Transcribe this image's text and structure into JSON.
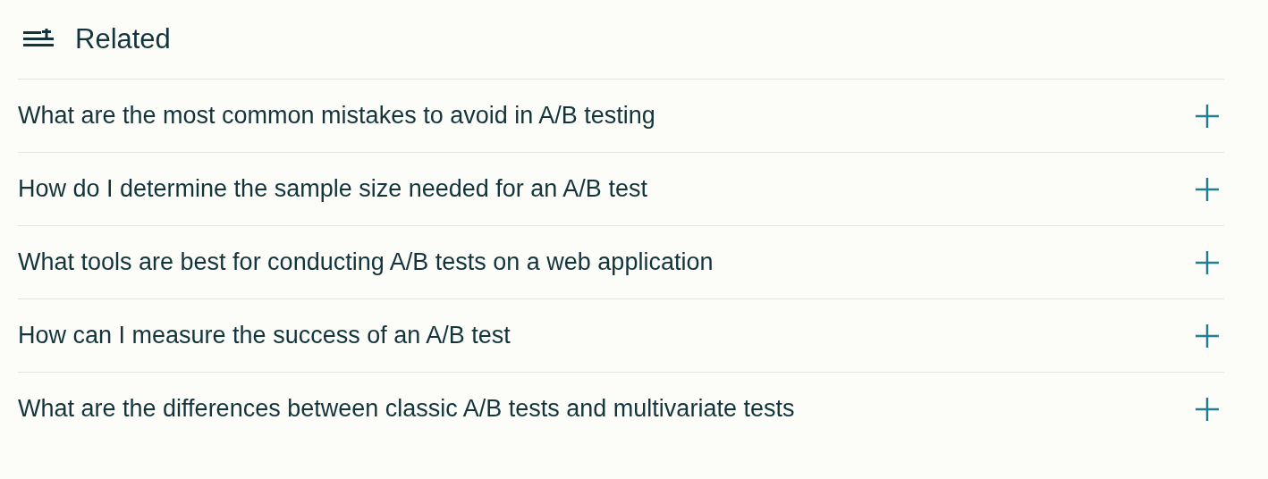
{
  "heading": "Related",
  "items": [
    {
      "text": "What are the most common mistakes to avoid in A/B testing"
    },
    {
      "text": "How do I determine the sample size needed for an A/B test"
    },
    {
      "text": "What tools are best for conducting A/B tests on a web application"
    },
    {
      "text": "How can I measure the success of an A/B test"
    },
    {
      "text": "What are the differences between classic A/B tests and multivariate tests"
    }
  ]
}
